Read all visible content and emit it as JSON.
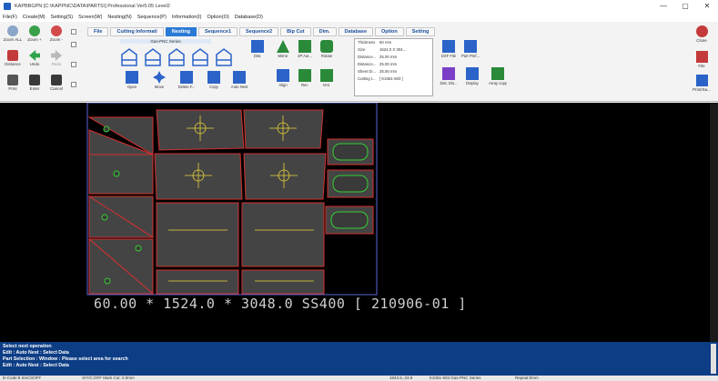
{
  "window": {
    "title": "KAPBBGPN [C:\\KAPPNC\\DATA\\PARTS\\] Professional Ver5.05 Level2",
    "minimize": "—",
    "maximize": "▢",
    "close": "✕"
  },
  "menu": [
    "File(F)",
    "Create(M)",
    "Setting(S)",
    "Screen(W)",
    "Nesting(N)",
    "Sequence(P)",
    "Information(I)",
    "Option(O)",
    "Database(D)"
  ],
  "tabs": [
    "File",
    "Cutting Informati",
    "Nesting",
    "Sequence1",
    "Sequence2",
    "Bip Cut",
    "Dim.",
    "Database",
    "Option",
    "Setting"
  ],
  "active_tab": "Nesting",
  "left_tools": {
    "zoom_all": "Zoom ALL",
    "zoom_plus": "Zoom +",
    "zoom_minus": "Zoom -",
    "distance": "Distance",
    "undo": "Undo",
    "redo": "Redo",
    "print": "Print",
    "enter": "Enter",
    "cancel": "Cancel"
  },
  "nesting_group": {
    "label": "Gas-PNC Series",
    "buttons": [
      "Open",
      "Move",
      "Delete F...",
      "Copy",
      "Auto Nest",
      "Dist.",
      "Mirror",
      "2P Aut...",
      "Rotate",
      "Align",
      "Ret.",
      "Ven."
    ]
  },
  "info_list": [
    {
      "k": "Thickness",
      "v": "60 mm"
    },
    {
      "k": "Size",
      "v": "1524.0 X 304..."
    },
    {
      "k": "Distance...",
      "v": "25.00 mm"
    },
    {
      "k": "Distance...",
      "v": "25.00 mm"
    },
    {
      "k": "Sheet Di...",
      "v": "25.00 mm"
    },
    {
      "k": "Cutting t...",
      "v": "[ K3451-503 ]"
    }
  ],
  "right_group": {
    "buttons": [
      "DXF File",
      "Part Pref...",
      "Dist. Dis...",
      "Display",
      "Array copy"
    ]
  },
  "right_tools": {
    "close": "Close",
    "file": "File",
    "print_save": "Print/Sa..."
  },
  "sheet_label": "60.00 * 1524.0 * 3048.0 SS400 [ 210906-01 ]",
  "messages": [
    "Select next operation",
    "Edit : Auto Nest : Select Data",
    "Part Selection : Window : Please select area for search",
    "Edit : Auto Nest : Select Data"
  ],
  "status": {
    "code": "D-Code:9 SmCtrOFF",
    "mode": "X/Y/C:OFF Mark Cut: 0.0mm",
    "coords": "1843.5,-23.9",
    "machine": "K3451-503 Gas-PNC Series",
    "repeat": "Repeat:0mm"
  },
  "colors": {
    "accent": "#2a7ad6",
    "message_bg": "#0d3d85",
    "canvas_bg": "#000000",
    "part_fill": "#444444",
    "part_outline": "#d23030",
    "inner_outline": "#35d035",
    "part_mark": "#e8d23a",
    "sheet_outline": "#5a64d8"
  }
}
